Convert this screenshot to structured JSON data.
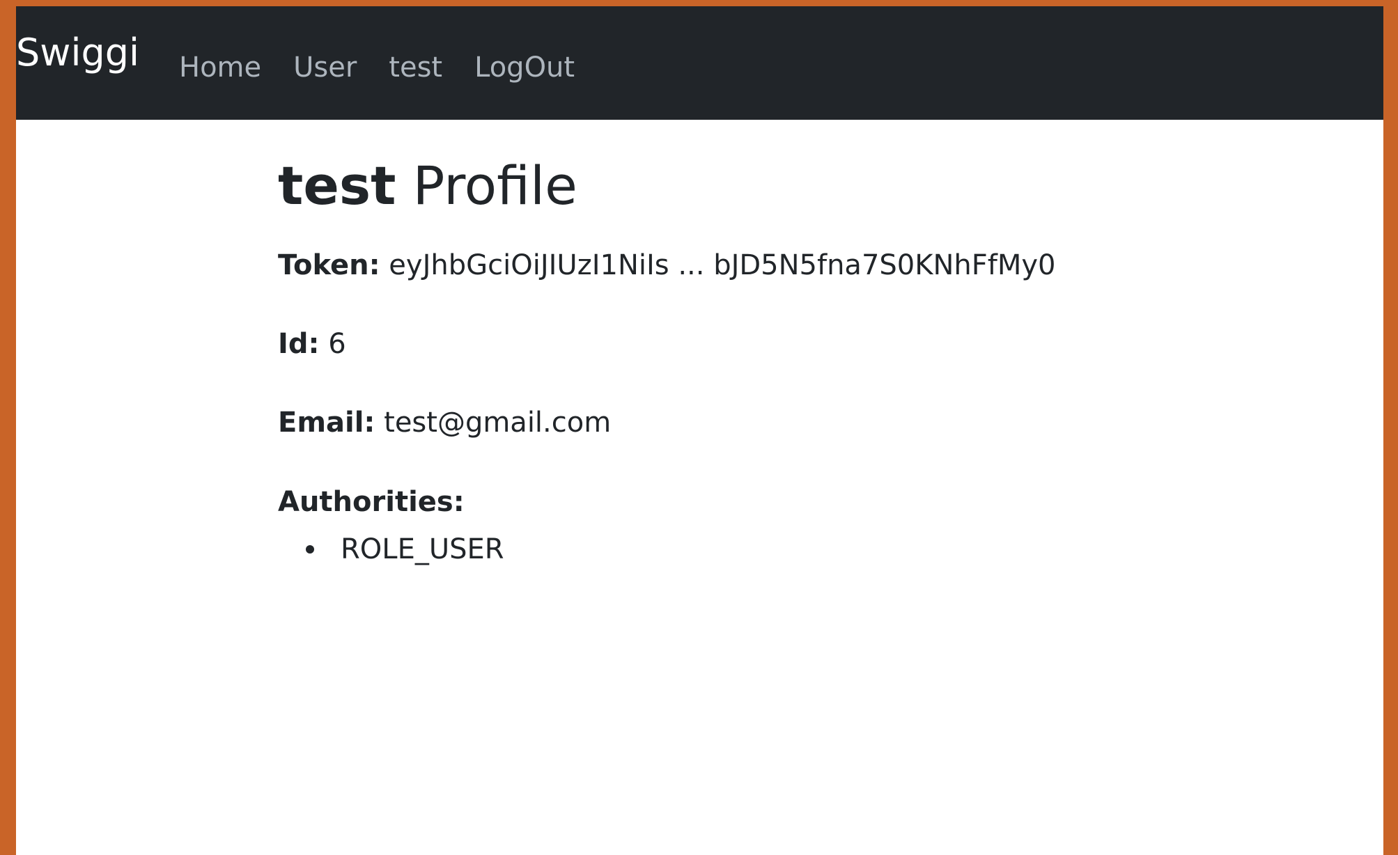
{
  "navbar": {
    "brand": "Swiggi",
    "links": [
      {
        "label": "Home"
      },
      {
        "label": "User"
      },
      {
        "label": "test"
      },
      {
        "label": "LogOut"
      }
    ]
  },
  "profile": {
    "username": "test",
    "title_suffix": " Profile",
    "token_label": "Token:",
    "token_value": " eyJhbGciOiJIUzI1NiIs ... bJD5N5fna7S0KNhFfMy0",
    "id_label": "Id:",
    "id_value": " 6",
    "email_label": "Email:",
    "email_value": " test@gmail.com",
    "authorities_label": "Authorities:",
    "authorities": [
      {
        "label": "ROLE_USER"
      }
    ]
  },
  "colors": {
    "frame_border": "#c96428",
    "navbar_bg": "#212529",
    "brand": "#ffffff",
    "nav_link": "#adb5bd",
    "text": "#212529"
  }
}
